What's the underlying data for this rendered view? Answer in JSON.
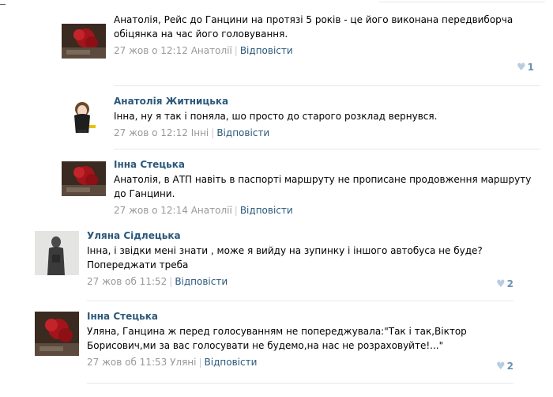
{
  "comments": [
    {
      "author": "",
      "text": "Анатолія, Рейс до Ганцини на протязі 5 років - це його виконана передвиборча обіцянка на час його головування.",
      "date": "27 жов о 12:12",
      "addressee": "Анатолії",
      "reply": "Відповісти",
      "likes": "1"
    },
    {
      "author": "Анатолія Житницька",
      "text": "Інна, ну я так і поняла, шо просто до старого розклад вернувся.",
      "date": "27 жов о 12:12",
      "addressee": "Інні",
      "reply": "Відповісти",
      "likes": ""
    },
    {
      "author": "Інна Стецька",
      "text": "Анатолія, в АТП навіть в паспорті маршруту не прописане продовження маршруту до Ганцини.",
      "date": "27 жов о 12:14",
      "addressee": "Анатолії",
      "reply": "Відповісти",
      "likes": ""
    },
    {
      "author": "Уляна Сідлецька",
      "text": "Інна, і звідки мені знати , може я вийду на зупинку і іншого автобуса не буде? Попереджати треба",
      "date": "27 жов об 11:52",
      "addressee": "",
      "reply": "Відповісти",
      "likes": "2"
    },
    {
      "author": "Інна Стецька",
      "text": "Уляна, Ганцина ж перед голосуванням не попереджувала:\"Так і так,Віктор Борисович,ми за вас голосувати не будемо,на нас не розраховуйте!...\"",
      "date": "27 жов об 11:53",
      "addressee": "Уляні",
      "reply": "Відповісти",
      "likes": "2"
    }
  ],
  "icons": {
    "avatar_roses": "roses-avatar-icon",
    "avatar_girl": "girl-avatar-icon",
    "avatar_person": "person-avatar-icon",
    "like": "heart-icon"
  },
  "colors": {
    "author": "#2b587a",
    "meta": "#999999",
    "like_heart": "#b9cde0",
    "divider": "#e7e8ec"
  }
}
